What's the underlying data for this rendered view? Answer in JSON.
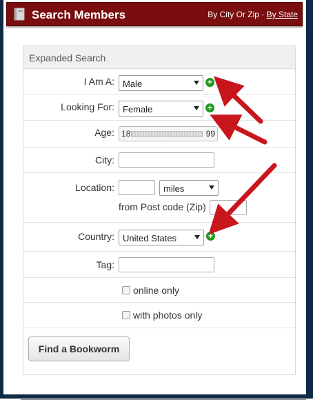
{
  "header": {
    "title": "Search Members",
    "by_city_or_zip": "By City Or Zip",
    "separator": "·",
    "by_state": "By State"
  },
  "form": {
    "section_title": "Expanded Search",
    "i_am_a": {
      "label": "I Am A:",
      "value": "Male"
    },
    "looking_for": {
      "label": "Looking For:",
      "value": "Female"
    },
    "age": {
      "label": "Age:",
      "min": "18",
      "max": "99"
    },
    "city": {
      "label": "City:",
      "value": ""
    },
    "location": {
      "label": "Location:",
      "value": "",
      "unit": "miles",
      "from_label": "from Post code (Zip)",
      "zip": ""
    },
    "country": {
      "label": "Country:",
      "value": "United States"
    },
    "tag": {
      "label": "Tag:",
      "value": ""
    },
    "online_only": {
      "label": "online only",
      "checked": false
    },
    "with_photos_only": {
      "label": "with photos only",
      "checked": false
    },
    "submit_label": "Find a Bookworm"
  },
  "colors": {
    "header_bg": "#7a0d0e",
    "outer_bg": "#0f2a44",
    "arrow": "#c8161d",
    "plus": "#1f9a1f"
  }
}
